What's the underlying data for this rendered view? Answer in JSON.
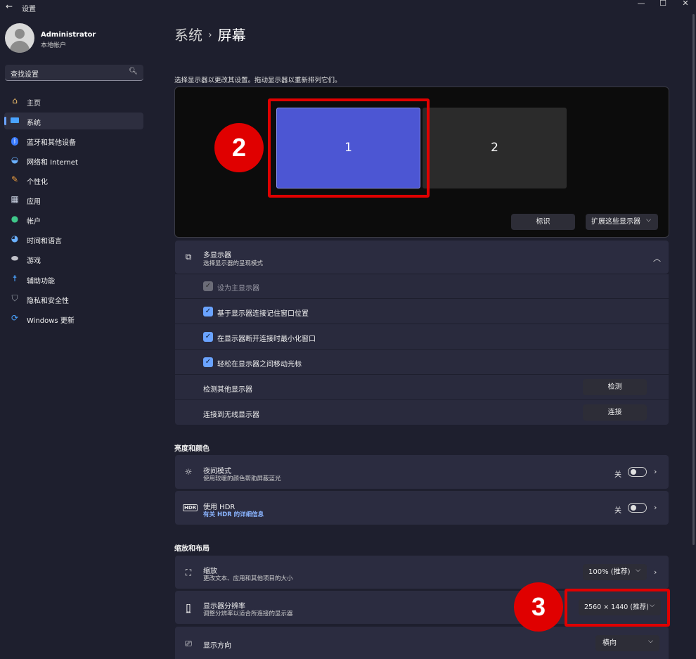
{
  "window": {
    "title": "设置",
    "back": "←",
    "minimize": "—",
    "maximize": "☐",
    "close": "✕"
  },
  "user": {
    "name": "Administrator",
    "type": "本地帐户"
  },
  "search": {
    "placeholder": "查找设置"
  },
  "sidebar": {
    "items": [
      {
        "label": "主页",
        "icon": "home-icon"
      },
      {
        "label": "系统",
        "icon": "system-icon",
        "active": true
      },
      {
        "label": "蓝牙和其他设备",
        "icon": "bluetooth-icon"
      },
      {
        "label": "网络和 Internet",
        "icon": "wifi-icon"
      },
      {
        "label": "个性化",
        "icon": "brush-icon"
      },
      {
        "label": "应用",
        "icon": "apps-icon"
      },
      {
        "label": "帐户",
        "icon": "account-icon"
      },
      {
        "label": "时间和语言",
        "icon": "globe-icon"
      },
      {
        "label": "游戏",
        "icon": "gamepad-icon"
      },
      {
        "label": "辅助功能",
        "icon": "accessibility-icon"
      },
      {
        "label": "隐私和安全性",
        "icon": "shield-icon"
      },
      {
        "label": "Windows 更新",
        "icon": "update-icon"
      }
    ]
  },
  "breadcrumb": {
    "parent": "系统",
    "separator": "›",
    "current": "屏幕"
  },
  "arrangement": {
    "hint": "选择显示器以更改其设置。拖动显示器以重新排列它们。",
    "monitor1": "1",
    "monitor2": "2",
    "identify_label": "标识",
    "extend_label": "扩展这些显示器",
    "extend_chevron": "⌵"
  },
  "multi_display": {
    "title": "多显示器",
    "subtitle": "选择显示器的呈现模式",
    "collapse_chevron": "︿",
    "checkboxes": [
      {
        "label": "设为主显示器",
        "checked": true,
        "disabled": true
      },
      {
        "label": "基于显示器连接记住窗口位置",
        "checked": true
      },
      {
        "label": "在显示器断开连接时最小化窗口",
        "checked": true
      },
      {
        "label": "轻松在显示器之间移动光标",
        "checked": true
      }
    ],
    "detect_label": "检测其他显示器",
    "detect_button": "检测",
    "connect_label": "连接到无线显示器",
    "connect_button": "连接"
  },
  "brightness": {
    "section": "亮度和颜色",
    "night_title": "夜间模式",
    "night_sub": "使用较暖的颜色帮助屏蔽蓝光",
    "night_state": "关",
    "hdr_title": "使用 HDR",
    "hdr_link": "有关 HDR 的详细信息",
    "hdr_state": "关"
  },
  "layout": {
    "section": "缩放和布局",
    "scale_title": "缩放",
    "scale_sub": "更改文本、应用和其他项目的大小",
    "scale_value": "100% (推荐)",
    "res_title": "显示器分辨率",
    "res_sub": "调整分辨率以适合所连接的显示器",
    "res_value": "2560 × 1440 (推荐)",
    "orient_title": "显示方向",
    "orient_value": "横向"
  },
  "annotations": {
    "badge2": "2",
    "badge3": "3",
    "color": "#e00000"
  }
}
